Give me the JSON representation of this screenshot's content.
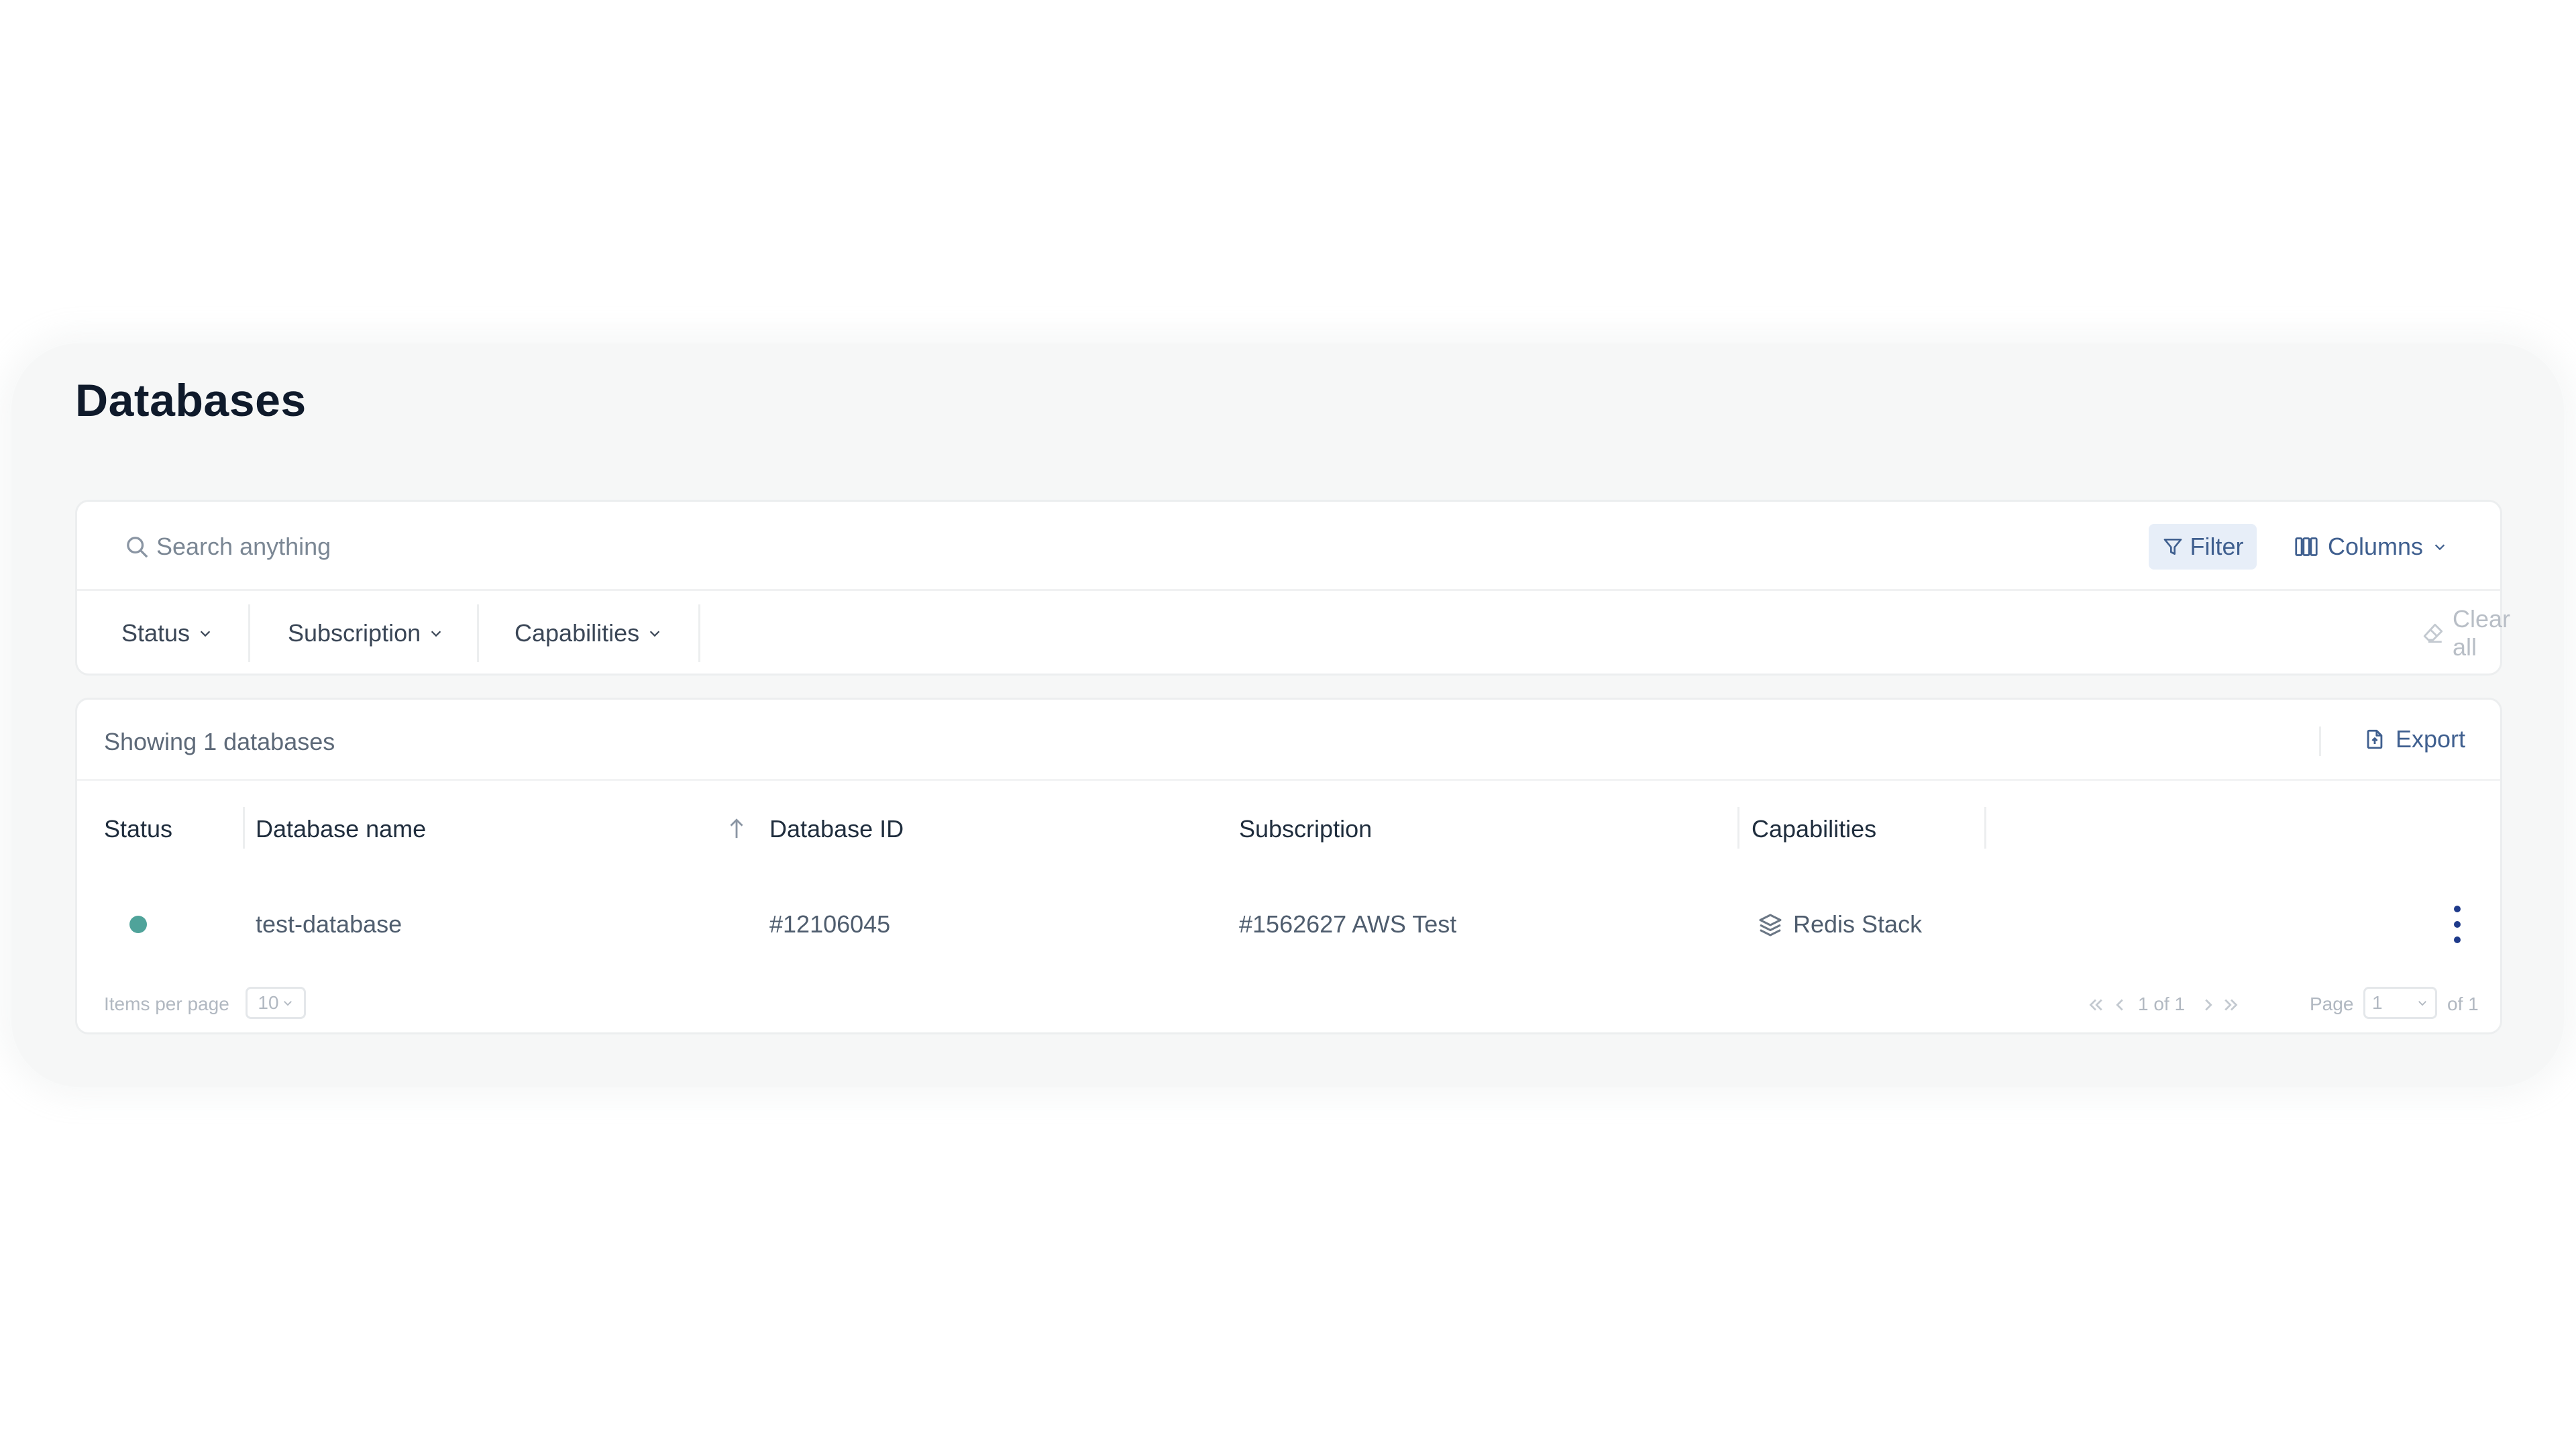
{
  "page": {
    "title": "Databases"
  },
  "search": {
    "placeholder": "Search anything",
    "value": ""
  },
  "toolbar": {
    "filter_label": "Filter",
    "columns_label": "Columns"
  },
  "facets": [
    {
      "label": "Status"
    },
    {
      "label": "Subscription"
    },
    {
      "label": "Capabilities"
    }
  ],
  "clear_all_label": "Clear all",
  "table": {
    "summary": "Showing 1 databases",
    "export_label": "Export",
    "columns": [
      "Status",
      "Database name",
      "Database ID",
      "Subscription",
      "Capabilities"
    ],
    "rows": [
      {
        "status_color": "#4fa39a",
        "name": "test-database",
        "id": "#12106045",
        "subscription": "#1562627 AWS Test",
        "capabilities": "Redis Stack"
      }
    ]
  },
  "pagination": {
    "items_per_page_label": "Items per page",
    "items_per_page_value": "10",
    "range_text": "1 of 1",
    "page_label": "Page",
    "page_value": "1",
    "page_total": "of 1"
  },
  "colors": {
    "accent": "#3f5f8f",
    "status_active": "#4fa39a",
    "kebab": "#1e3a8a"
  }
}
